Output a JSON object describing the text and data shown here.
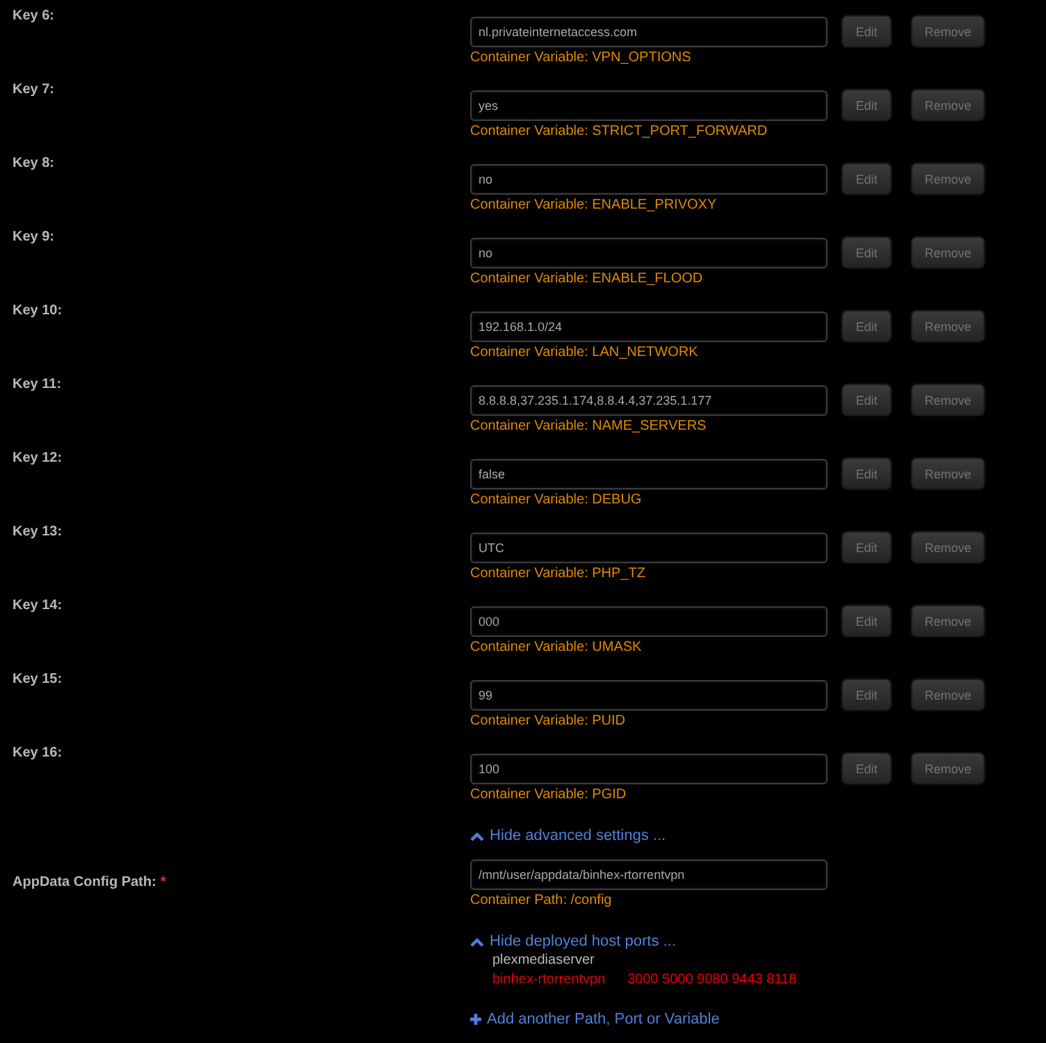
{
  "keys": [
    {
      "label": "Key 6:",
      "value": "nl.privateinternetaccess.com",
      "note": "Container Variable: VPN_OPTIONS",
      "actions": [
        "Edit",
        "Remove"
      ]
    },
    {
      "label": "Key 7:",
      "value": "yes",
      "note": "Container Variable: STRICT_PORT_FORWARD",
      "actions": [
        "Edit",
        "Remove"
      ]
    },
    {
      "label": "Key 8:",
      "value": "no",
      "note": "Container Variable: ENABLE_PRIVOXY",
      "actions": [
        "Edit",
        "Remove"
      ]
    },
    {
      "label": "Key 9:",
      "value": "no",
      "note": "Container Variable: ENABLE_FLOOD",
      "actions": [
        "Edit",
        "Remove"
      ]
    },
    {
      "label": "Key 10:",
      "value": "192.168.1.0/24",
      "note": "Container Variable: LAN_NETWORK",
      "actions": [
        "Edit",
        "Remove"
      ]
    },
    {
      "label": "Key 11:",
      "value": "8.8.8.8,37.235.1.174,8.8.4.4,37.235.1.177",
      "note": "Container Variable: NAME_SERVERS",
      "actions": [
        "Edit",
        "Remove"
      ]
    },
    {
      "label": "Key 12:",
      "value": "false",
      "note": "Container Variable: DEBUG",
      "actions": [
        "Edit",
        "Remove"
      ]
    },
    {
      "label": "Key 13:",
      "value": "UTC",
      "note": "Container Variable: PHP_TZ",
      "actions": [
        "Edit",
        "Remove"
      ]
    },
    {
      "label": "Key 14:",
      "value": "000",
      "note": "Container Variable: UMASK",
      "actions": [
        "Edit",
        "Remove"
      ]
    },
    {
      "label": "Key 15:",
      "value": "99",
      "note": "Container Variable: PUID",
      "actions": [
        "Edit",
        "Remove"
      ]
    },
    {
      "label": "Key 16:",
      "value": "100",
      "note": "Container Variable: PGID",
      "actions": [
        "Edit",
        "Remove"
      ]
    }
  ],
  "advanced_toggle": {
    "label": "Hide advanced settings ..."
  },
  "appdata": {
    "label": "AppData Config Path:",
    "required_mark": "*",
    "value": "/mnt/user/appdata/binhex-rtorrentvpn",
    "note": "Container Path: /config"
  },
  "ports_toggle": {
    "label": "Hide deployed host ports ..."
  },
  "host_ports": [
    {
      "name": "plexmediaserver",
      "color": "#bbbbbb"
    },
    {
      "name": "binhex-rtorrentvpn",
      "ports": "3000 5000 9080 9443 8118",
      "color": "#e50000"
    }
  ],
  "add_link": {
    "label": "Add another Path, Port or Variable"
  }
}
